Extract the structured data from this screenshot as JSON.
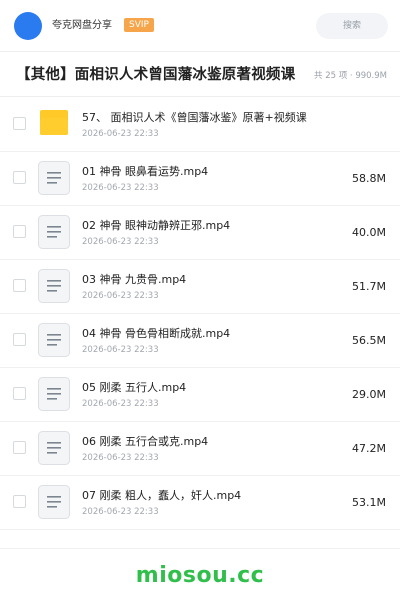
{
  "header": {
    "username": "夸克网盘分享",
    "badge": "SVIP",
    "search_placeholder": "搜索",
    "avatar_color": "#2b7bf0",
    "badge_color": "#f7a54a"
  },
  "share": {
    "title": "【其他】面相识人术曾国藩冰鉴原著视频课",
    "count_label": "共 25 项 · 990.9M"
  },
  "files": [
    {
      "name": "57、 面相识人术《曾国藩冰鉴》原著+视频课",
      "date": "2026-06-23 22:33",
      "size": "",
      "icon": "folder-icon"
    },
    {
      "name": "01 神骨 眼鼻看运势.mp4",
      "date": "2026-06-23 22:33",
      "size": "58.8M",
      "icon": "file-icon"
    },
    {
      "name": "02 神骨 眼神动静辨正邪.mp4",
      "date": "2026-06-23 22:33",
      "size": "40.0M",
      "icon": "file-icon"
    },
    {
      "name": "03 神骨 九贵骨.mp4",
      "date": "2026-06-23 22:33",
      "size": "51.7M",
      "icon": "file-icon"
    },
    {
      "name": "04 神骨 骨色骨相断成就.mp4",
      "date": "2026-06-23 22:33",
      "size": "56.5M",
      "icon": "file-icon"
    },
    {
      "name": "05 刚柔 五行人.mp4",
      "date": "2026-06-23 22:33",
      "size": "29.0M",
      "icon": "file-icon"
    },
    {
      "name": "06 刚柔 五行合或克.mp4",
      "date": "2026-06-23 22:33",
      "size": "47.2M",
      "icon": "file-icon"
    },
    {
      "name": "07 刚柔 粗人，蠢人，奸人.mp4",
      "date": "2026-06-23 22:33",
      "size": "53.1M",
      "icon": "file-icon"
    }
  ],
  "footer": {
    "brand": "miosou.cc",
    "brand_color": "#2fbf4a"
  }
}
